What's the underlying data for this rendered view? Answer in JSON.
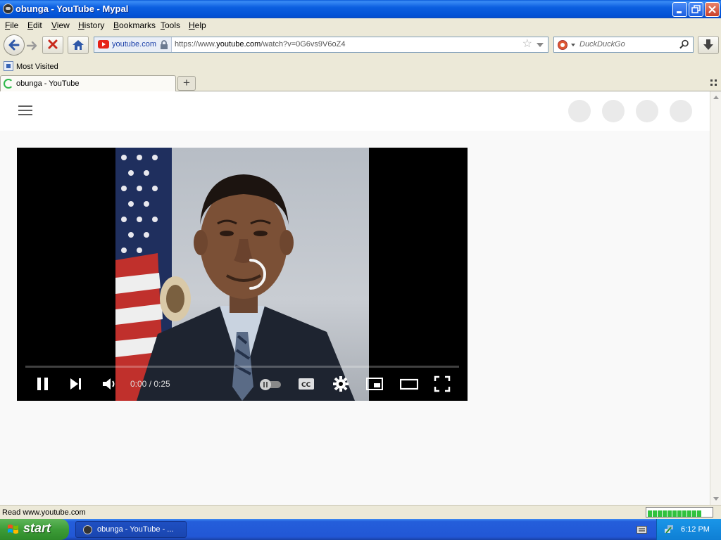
{
  "window": {
    "title": "obunga - YouTube - Mypal"
  },
  "menu": {
    "items": [
      {
        "label": "File",
        "key": "F",
        "rest": "ile"
      },
      {
        "label": "Edit",
        "key": "E",
        "rest": "dit"
      },
      {
        "label": "View",
        "key": "V",
        "rest": "iew"
      },
      {
        "label": "History",
        "key": "H",
        "rest": "istory"
      },
      {
        "label": "Bookmarks",
        "key": "B",
        "rest": "ookmarks"
      },
      {
        "label": "Tools",
        "key": "T",
        "rest": "ools"
      },
      {
        "label": "Help",
        "key": "H",
        "rest": "elp"
      }
    ]
  },
  "urlbar": {
    "identity_domain": "youtube.com",
    "url_prefix": "https://www.",
    "url_host": "youtube.com",
    "url_path": "/watch?v=0G6vs9V6oZ4"
  },
  "search": {
    "placeholder": "DuckDuckGo"
  },
  "bookmarks": {
    "most_visited": "Most Visited"
  },
  "tab": {
    "label": "obunga - YouTube",
    "new_tab_symbol": "+"
  },
  "player": {
    "time_current": "0:00",
    "time_total": "0:25",
    "time_display": "0:00 / 0:25",
    "progress_fraction": 0.0,
    "state": "loading"
  },
  "status": {
    "text": "Read www.youtube.com",
    "progress_segments": 11
  },
  "taskbar": {
    "start_label": "start",
    "task_label": "obunga - YouTube - ...",
    "clock": "6:12 PM"
  },
  "colors": {
    "titlebar_blue": "#0251d5",
    "taskbar_blue": "#245edb",
    "start_green": "#3c9c37",
    "youtube_red": "#e62117",
    "progress_green": "#31c23e"
  }
}
